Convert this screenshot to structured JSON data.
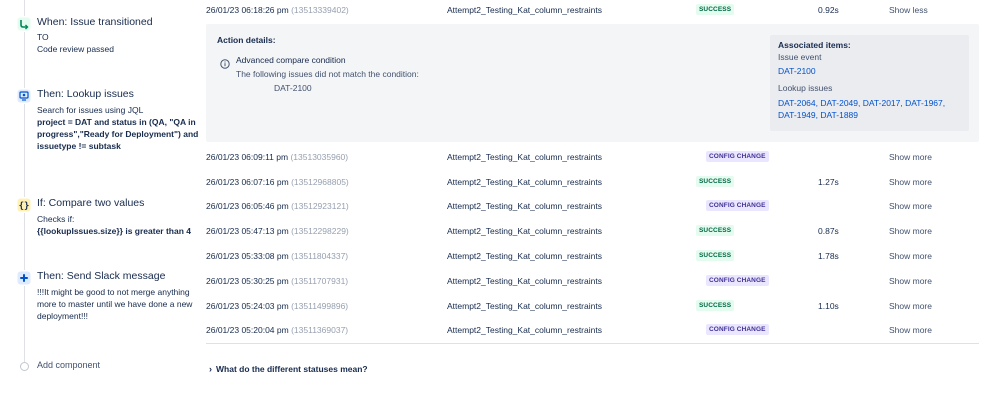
{
  "sidebar": {
    "components": [
      {
        "title": "When: Issue transitioned",
        "lines": [
          "TO",
          "Code review passed"
        ]
      },
      {
        "title": "Then: Lookup issues",
        "intro": "Search for issues using JQL",
        "jql": "project = DAT and status in (QA, \"QA in progress\",\"Ready for Deployment\") and issuetype != subtask"
      },
      {
        "title": "If: Compare two values",
        "intro": "Checks if:",
        "expr": "{{lookupIssues.size}} is greater than 4"
      },
      {
        "title": "Then: Send Slack message",
        "body": "!!!It might be good to not merge anything more to master until we have done a new deployment!!!"
      }
    ],
    "add_component": "Add component"
  },
  "log": {
    "expanded": {
      "timestamp": "26/01/23 06:18:26 pm",
      "id": "(13513339402)",
      "rule": "Attempt2_Testing_Kat_column_restraints",
      "status": "SUCCESS",
      "duration": "0.92s",
      "action": "Show less"
    },
    "details": {
      "heading": "Action details:",
      "condition_title": "Advanced compare condition",
      "condition_text": "The following issues did not match the condition:",
      "condition_issue": "DAT-2100",
      "associated_heading": "Associated items:",
      "issue_event_label": "Issue event",
      "issue_event": "DAT-2100",
      "lookup_label": "Lookup issues",
      "lookup_issues": [
        "DAT-2064",
        "DAT-2049",
        "DAT-2017",
        "DAT-1967",
        "DAT-1949",
        "DAT-1889"
      ]
    },
    "rows": [
      {
        "timestamp": "26/01/23 06:09:11 pm",
        "id": "(13513035960)",
        "rule": "Attempt2_Testing_Kat_column_restraints",
        "status": "CONFIG CHANGE",
        "duration": "",
        "action": "Show more"
      },
      {
        "timestamp": "26/01/23 06:07:16 pm",
        "id": "(13512968805)",
        "rule": "Attempt2_Testing_Kat_column_restraints",
        "status": "SUCCESS",
        "duration": "1.27s",
        "action": "Show more"
      },
      {
        "timestamp": "26/01/23 06:05:46 pm",
        "id": "(13512923121)",
        "rule": "Attempt2_Testing_Kat_column_restraints",
        "status": "CONFIG CHANGE",
        "duration": "",
        "action": "Show more"
      },
      {
        "timestamp": "26/01/23 05:47:13 pm",
        "id": "(13512298229)",
        "rule": "Attempt2_Testing_Kat_column_restraints",
        "status": "SUCCESS",
        "duration": "0.87s",
        "action": "Show more"
      },
      {
        "timestamp": "26/01/23 05:33:08 pm",
        "id": "(13511804337)",
        "rule": "Attempt2_Testing_Kat_column_restraints",
        "status": "SUCCESS",
        "duration": "1.78s",
        "action": "Show more"
      },
      {
        "timestamp": "26/01/23 05:30:25 pm",
        "id": "(13511707931)",
        "rule": "Attempt2_Testing_Kat_column_restraints",
        "status": "CONFIG CHANGE",
        "duration": "",
        "action": "Show more"
      },
      {
        "timestamp": "26/01/23 05:24:03 pm",
        "id": "(13511499896)",
        "rule": "Attempt2_Testing_Kat_column_restraints",
        "status": "SUCCESS",
        "duration": "1.10s",
        "action": "Show more"
      },
      {
        "timestamp": "26/01/23 05:20:04 pm",
        "id": "(13511369037)",
        "rule": "Attempt2_Testing_Kat_column_restraints",
        "status": "CONFIG CHANGE",
        "duration": "",
        "action": "Show more"
      }
    ],
    "faq": "What do the different statuses mean?"
  },
  "colors": {
    "success_bg": "#e3fcef",
    "success_fg": "#006644",
    "config_bg": "#eae6ff",
    "config_fg": "#403294",
    "link": "#0052cc"
  },
  "icons": {
    "trigger": "branch-arrow-icon",
    "lookup": "monitor-search-icon",
    "condition": "curly-braces-icon",
    "slack": "slack-icon",
    "info": "info-icon",
    "faq": "chevron-right-icon"
  }
}
